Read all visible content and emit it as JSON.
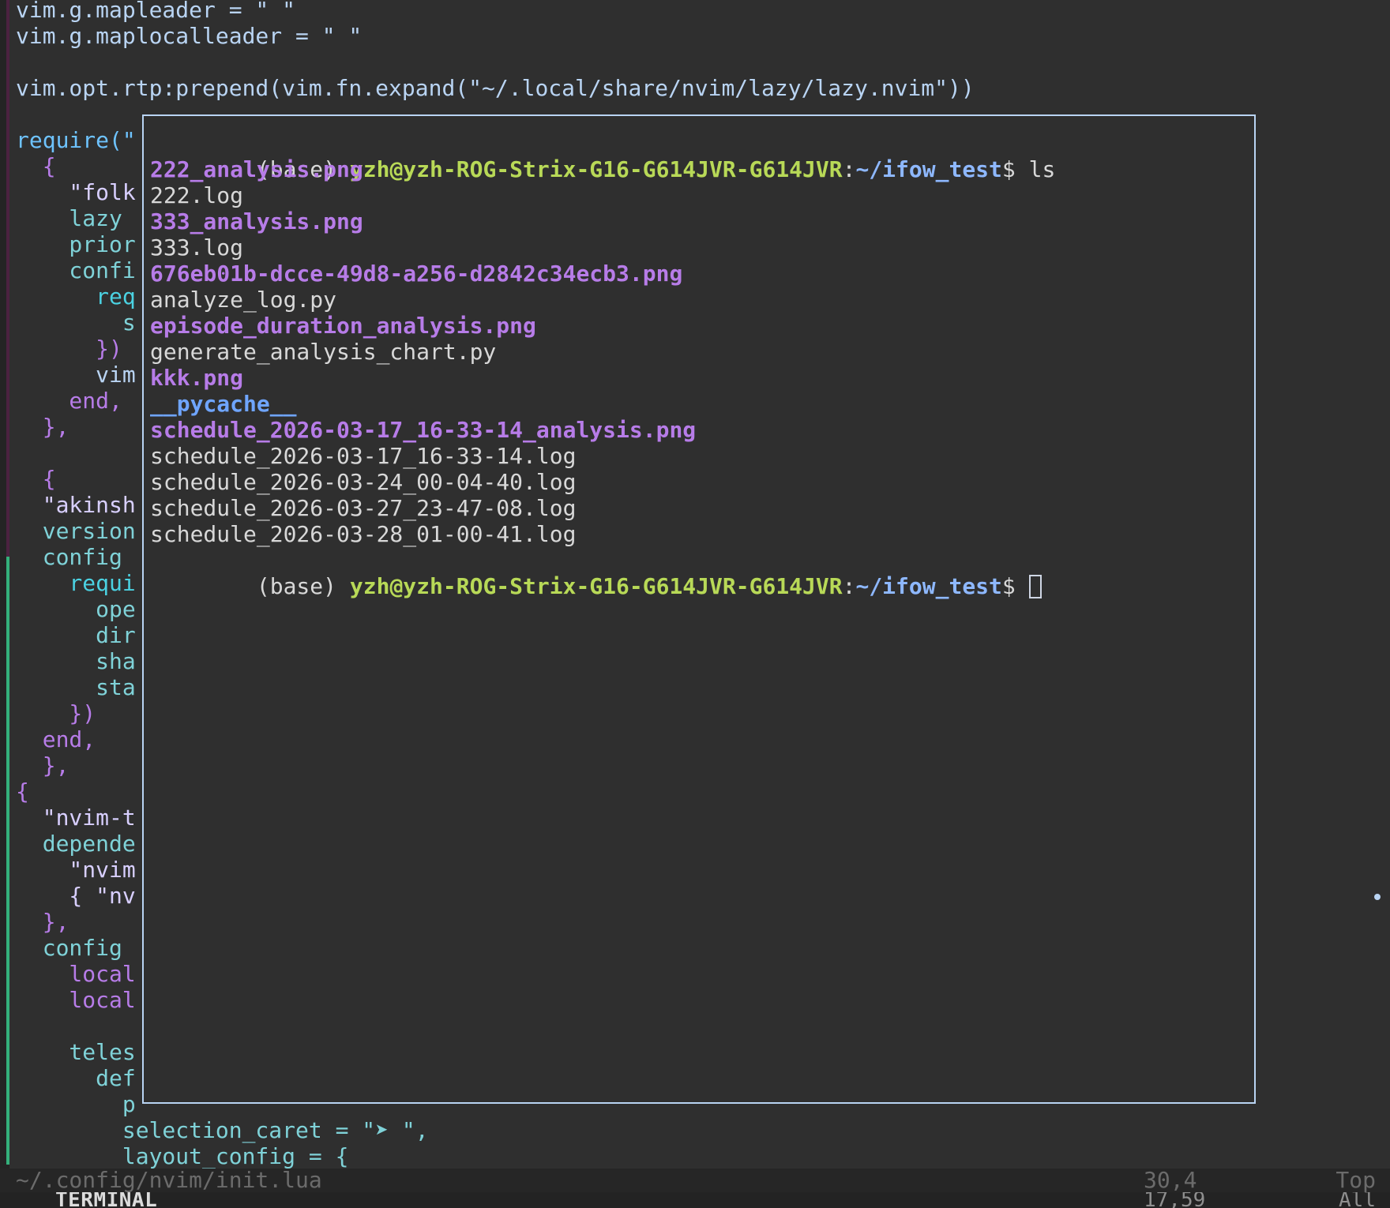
{
  "editor": {
    "lines": [
      "vim.g.mapleader = \" \"",
      "vim.g.maplocalleader = \" \"",
      "",
      "vim.opt.rtp:prepend(vim.fn.expand(\"~/.local/share/nvim/lazy/lazy.nvim\"))",
      "",
      "require(\"",
      "  {",
      "    \"folk",
      "    lazy",
      "    prior",
      "    confi",
      "      req",
      "        s",
      "      })",
      "      vim",
      "    end,",
      "  },",
      "",
      "  {",
      "  \"akinsh",
      "  version",
      "  config",
      "    requi",
      "      ope",
      "      dir",
      "      sha",
      "      sta",
      "    })",
      "  end,",
      "  },",
      "{",
      "  \"nvim-t",
      "  depende",
      "    \"nvim",
      "    { \"nv",
      "  },",
      "  config",
      "    local",
      "    local",
      "",
      "    teles",
      "      def",
      "        p",
      "        selection_caret = \"➤ \",",
      "        layout_config = {"
    ]
  },
  "terminal": {
    "prompt_env": "(base)",
    "prompt_user": "yzh@yzh-ROG-Strix-G16-G614JVR-G614JVR",
    "prompt_sep": ":",
    "prompt_path": "~/ifow_test",
    "prompt_suffix": "$",
    "command": "ls",
    "files": [
      {
        "name": "222_analysis.png",
        "kind": "image"
      },
      {
        "name": "222.log",
        "kind": "file"
      },
      {
        "name": "333_analysis.png",
        "kind": "image"
      },
      {
        "name": "333.log",
        "kind": "file"
      },
      {
        "name": "676eb01b-dcce-49d8-a256-d2842c34ecb3.png",
        "kind": "image"
      },
      {
        "name": "analyze_log.py",
        "kind": "file"
      },
      {
        "name": "episode_duration_analysis.png",
        "kind": "image"
      },
      {
        "name": "generate_analysis_chart.py",
        "kind": "file"
      },
      {
        "name": "kkk.png",
        "kind": "image"
      },
      {
        "name": "__pycache__",
        "kind": "dir"
      },
      {
        "name": "schedule_2026-03-17_16-33-14_analysis.png",
        "kind": "image"
      },
      {
        "name": "schedule_2026-03-17_16-33-14.log",
        "kind": "file"
      },
      {
        "name": "schedule_2026-03-24_00-04-40.log",
        "kind": "file"
      },
      {
        "name": "schedule_2026-03-27_23-47-08.log",
        "kind": "file"
      },
      {
        "name": "schedule_2026-03-28_01-00-41.log",
        "kind": "file"
      }
    ]
  },
  "status": {
    "file_path": "~/.config/nvim/init.lua",
    "cursor_pos": "30,4",
    "scroll": "Top"
  },
  "tabbar": {
    "label": "TERMINAL",
    "pos": "17,59",
    "scroll": "All"
  },
  "colors": {
    "background": "#2f2f2f",
    "accent_border": "#b9d4f3",
    "image_file": "#b77ce8",
    "user_host": "#b8d957",
    "path": "#8eb8ff"
  }
}
